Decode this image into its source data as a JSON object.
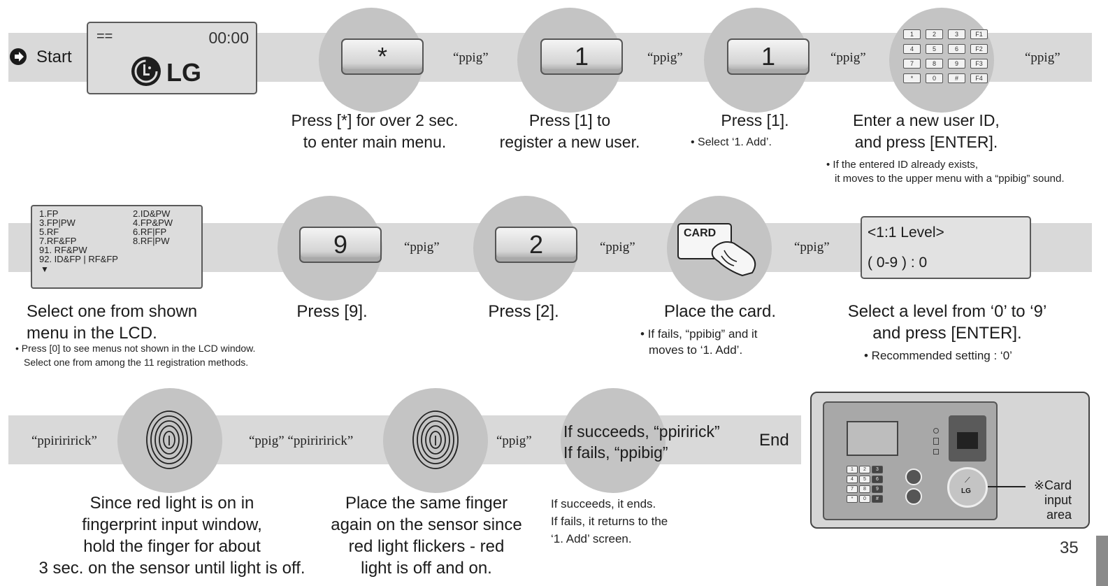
{
  "row1": {
    "start_label": "Start",
    "lcd": {
      "marks": "==",
      "time": "00:00",
      "logo": "LG"
    },
    "sounds": [
      "“ppig”",
      "“ppig”",
      "“ppig”",
      "“ppig”"
    ],
    "keys": [
      "*",
      "1",
      "1"
    ],
    "keypad": [
      "1",
      "2",
      "3",
      "F1",
      "4",
      "5",
      "6",
      "F2",
      "7",
      "8",
      "9",
      "F3",
      "*",
      "0",
      "#",
      "F4"
    ],
    "captions": [
      [
        "Press [*] for over 2 sec.",
        "to enter main menu."
      ],
      [
        "Press [1] to",
        "register a new user."
      ],
      [
        "Press [1]."
      ],
      [
        "Enter a new user ID,",
        "and press [ENTER]."
      ]
    ],
    "note_select_add": "• Select ‘1. Add’.",
    "note_id_exists": [
      "• If the entered ID already exists,",
      "it moves to the upper menu with a “ppibig” sound."
    ]
  },
  "row2": {
    "menu": [
      "1.FP",
      "2.ID&PW",
      "3.FP|PW",
      "4.FP&PW",
      "5.RF",
      "6.RF|FP",
      "7.RF&FP",
      "8.RF|PW",
      "91. RF&PW",
      "92. ID&FP | RF&FP",
      "▼"
    ],
    "keys": [
      "9",
      "2"
    ],
    "sounds": [
      "“ppig”",
      "“ppig”",
      "“ppig”"
    ],
    "card_label": "CARD",
    "level_lcd": [
      "<1:1 Level>",
      "( 0-9 ) : 0"
    ],
    "captions": [
      [
        "Select one from shown",
        "menu in the LCD."
      ],
      [
        "Press [9]."
      ],
      [
        "Press [2]."
      ],
      [
        "Place the card."
      ],
      [
        "Select a level from ‘0’ to ‘9’",
        "and press [ENTER]."
      ]
    ],
    "note_menu": [
      "• Press [0] to see menus not shown in the LCD window.",
      "Select one from among the 11 registration methods."
    ],
    "note_card": [
      "• If fails, “ppibig” and it",
      "moves to ‘1. Add’."
    ],
    "note_level": "• Recommended setting : ‘0’"
  },
  "row3": {
    "sounds": [
      "“ppiriririck”",
      "“ppig” “ppiriririck”",
      "“ppig”"
    ],
    "result": [
      "If succeeds, “ppiririck”",
      "If fails, “ppibig”"
    ],
    "end_label": "End",
    "captions": [
      [
        "Since red light is on in",
        "fingerprint input window,",
        "hold the finger for about",
        "3 sec. on the sensor until light is off."
      ],
      [
        "Place the same finger",
        "again on the sensor since",
        "red light flickers - red",
        "light is off and on."
      ]
    ],
    "note_result": [
      "If succeeds, it ends.",
      "If fails, it returns to the",
      "‘1. Add’ screen."
    ],
    "device_keys": [
      "1",
      "2",
      "3",
      "4",
      "5",
      "6",
      "7",
      "8",
      "9",
      "*",
      "0",
      "#"
    ],
    "device_logo": "LG",
    "card_area_label": [
      "※Card",
      "input",
      "area"
    ]
  },
  "page_number": "35"
}
